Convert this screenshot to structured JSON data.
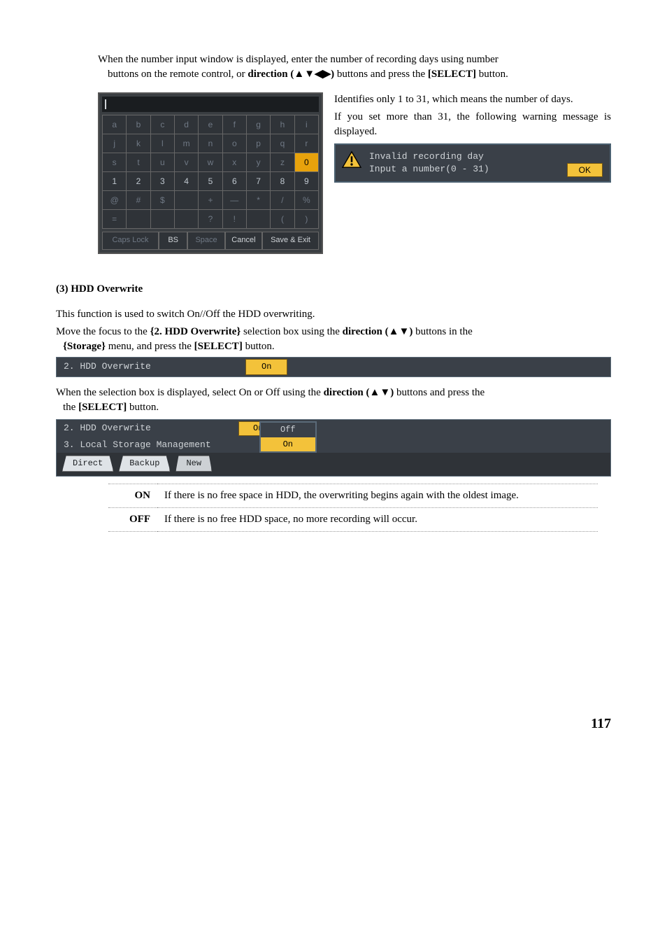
{
  "para1a": "When the number input window is displayed, enter the number of recording days using number",
  "para1b_pre": "buttons on the remote control, or ",
  "para1b_dir": "direction (▲▼◀▶)",
  "para1b_mid": " buttons and press the ",
  "para1b_sel": "[SELECT]",
  "para1b_post": " button.",
  "right1": "Identifies only 1 to 31, which means the number of days.",
  "right2": "If you set more than 31, the following warning message is displayed.",
  "warn_l1": "Invalid recording day",
  "warn_l2": "Input a number(0 - 31)",
  "warn_ok": "OK",
  "kbd": {
    "r1": [
      "a",
      "b",
      "c",
      "d",
      "e",
      "f",
      "g",
      "h",
      "i"
    ],
    "r2": [
      "j",
      "k",
      "l",
      "m",
      "n",
      "o",
      "p",
      "q",
      "r"
    ],
    "r3": [
      "s",
      "t",
      "u",
      "v",
      "w",
      "x",
      "y",
      "z",
      "0"
    ],
    "r4": [
      "1",
      "2",
      "3",
      "4",
      "5",
      "6",
      "7",
      "8",
      "9"
    ],
    "r5": [
      "@",
      "#",
      "$",
      "",
      "+",
      "—",
      "*",
      "/",
      "%"
    ],
    "r6": [
      "=",
      "",
      "",
      "",
      "?",
      "!",
      "",
      "(",
      ")"
    ],
    "bottom": {
      "caps": "Caps Lock",
      "bs": "BS",
      "space": "Space",
      "cancel": "Cancel",
      "save": "Save & Exit"
    }
  },
  "sec3_num": "(3)",
  "sec3_title": "HDD Overwrite",
  "sec3_p1": "This function is used to switch On//Off the HDD overwriting.",
  "sec3_p2_pre": "Move the focus to the ",
  "sec3_p2_b1": "{2. HDD Overwrite}",
  "sec3_p2_mid1": " selection box using the ",
  "sec3_p2_dir": "direction (▲▼)",
  "sec3_p2_mid2": " buttons in the ",
  "sec3_p2_b2": "{Storage}",
  "sec3_p2_mid3": " menu, and press the ",
  "sec3_p2_sel": "[SELECT]",
  "sec3_p2_post": " button.",
  "menubar_label": "2. HDD Overwrite",
  "menubar_val": "On",
  "sec3_p3_pre": "When the selection box is displayed, select On or Off using the ",
  "sec3_p3_dir": "direction (▲▼)",
  "sec3_p3_mid": " buttons and press the ",
  "sec3_p3_sel": "[SELECT]",
  "sec3_p3_post": " button.",
  "menu2_l1": "2. HDD Overwrite",
  "menu2_l1_val": "On",
  "menu2_l2": "3. Local Storage Management",
  "tabs": {
    "direct": "Direct",
    "backup": "Backup",
    "new": "New"
  },
  "dd_off": "Off",
  "dd_on": "On",
  "def_on_k": "ON",
  "def_on_v": "If there is no free space in HDD, the overwriting begins again with the oldest image.",
  "def_off_k": "OFF",
  "def_off_v": "If there is no free HDD space, no more recording will occur.",
  "page": "117"
}
